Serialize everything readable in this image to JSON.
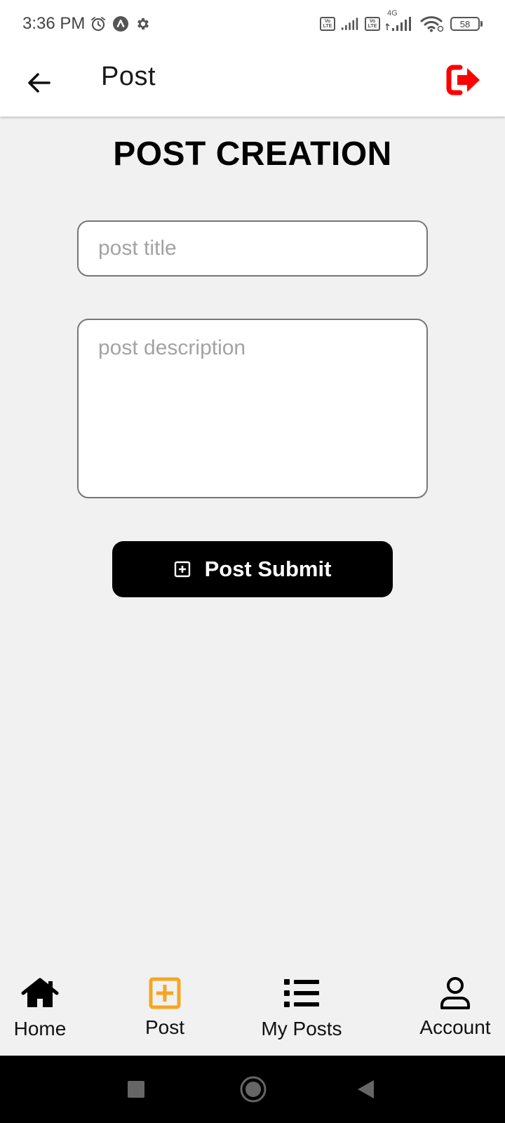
{
  "status_bar": {
    "time": "3:36 PM",
    "battery": "58",
    "network": "4G",
    "volte_label": "Vo LTE",
    "icons": [
      "alarm-icon",
      "app-logo-icon",
      "settings-gear-icon",
      "volte-icon",
      "signal-icon",
      "volte-icon",
      "signal-4g-icon",
      "wifi-icon",
      "battery-icon"
    ]
  },
  "app_bar": {
    "title": "Post",
    "back_icon": "arrow-left-icon",
    "logout_icon": "sign-out-icon",
    "logout_color": "#ff0000"
  },
  "main": {
    "heading": "POST CREATION",
    "title_input": {
      "placeholder": "post title",
      "value": ""
    },
    "description_input": {
      "placeholder": "post description",
      "value": ""
    },
    "submit_button": {
      "label": "Post Submit",
      "icon": "plus-square-icon"
    }
  },
  "bottom_nav": {
    "active_color": "#f5a623",
    "items": [
      {
        "label": "Home",
        "icon": "home-icon",
        "active": false
      },
      {
        "label": "Post",
        "icon": "plus-square-icon",
        "active": true
      },
      {
        "label": "My Posts",
        "icon": "list-icon",
        "active": false
      },
      {
        "label": "Account",
        "icon": "user-icon",
        "active": false
      }
    ]
  },
  "system_nav": {
    "buttons": [
      "recent-apps-icon",
      "home-circle-icon",
      "back-triangle-icon"
    ]
  }
}
